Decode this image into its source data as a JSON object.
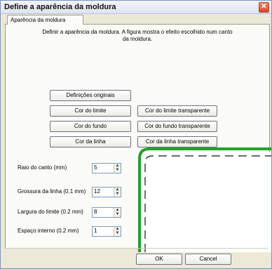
{
  "window": {
    "title": "Define a aparência da moldura",
    "close_glyph": "✕"
  },
  "tab": {
    "label": "Aparência da moldura"
  },
  "description": "Definir a aparência da moldura. A figura mostra o efeito escolhido num canto da moldura.",
  "buttons": {
    "defaults": "Definições originais",
    "border_color": "Cor do limite",
    "border_transparent": "Cor do limite transparente",
    "background_color": "Cor do fundo",
    "background_transparent": "Cor do fundo transparente",
    "line_color": "Cor da linha",
    "line_transparent": "Cor da linha transparente",
    "ok": "OK",
    "cancel": "Cancel"
  },
  "fields": [
    {
      "label": "Raio do canto (mm)",
      "value": "5"
    },
    {
      "label": "Grossura da linha (0.1 mm)",
      "value": "12"
    },
    {
      "label": "Largura do limite (0.2 mm)",
      "value": "8"
    },
    {
      "label": "Espaço interno (0.2 mm)",
      "value": "1"
    }
  ],
  "colors": {
    "frame_border": "#22a02a",
    "dashed_line": "#111111"
  }
}
